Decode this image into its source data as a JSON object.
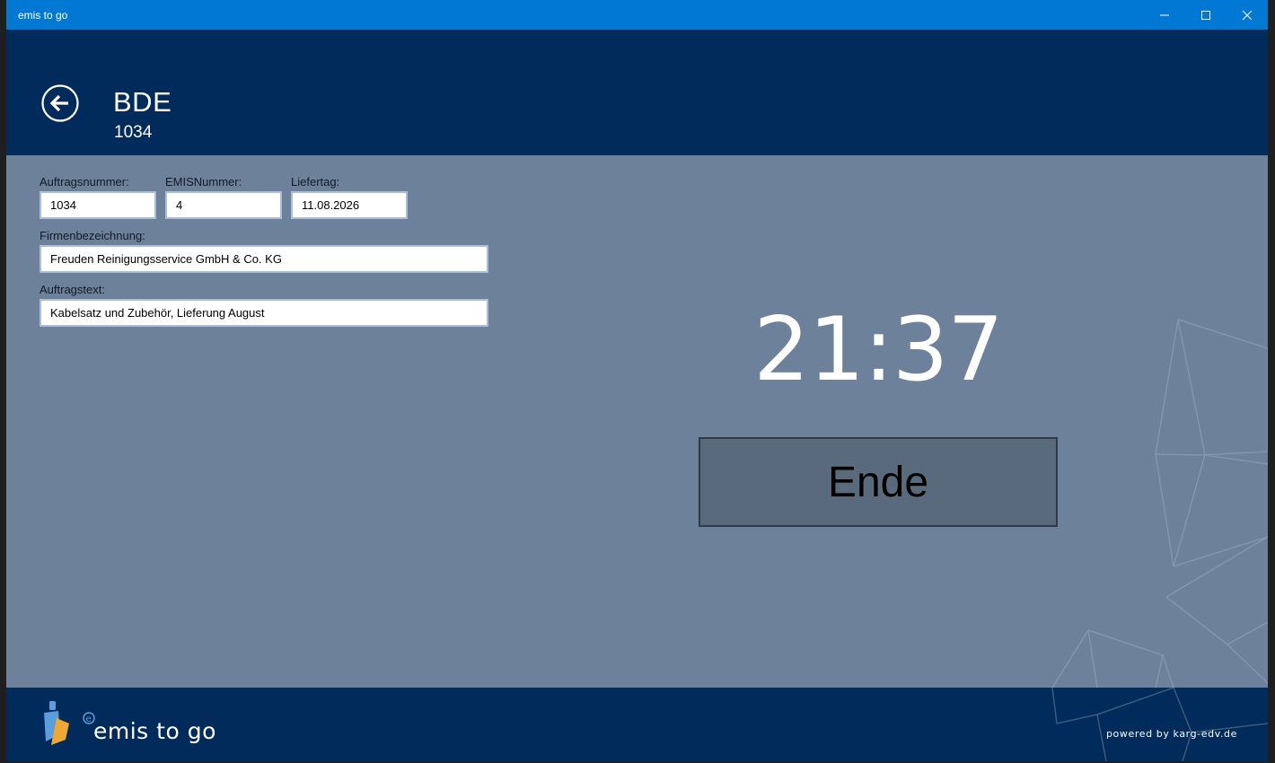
{
  "window": {
    "title": "emis to go",
    "controls": {
      "minimize": "minimize-icon",
      "maximize": "maximize-icon",
      "close": "close-icon"
    }
  },
  "header": {
    "back_icon": "back-arrow-icon",
    "title": "BDE",
    "subtitle": "1034"
  },
  "form": {
    "auftragsnummer": {
      "label": "Auftragsnummer:",
      "value": "1034"
    },
    "emisnummer": {
      "label": "EMISNummer:",
      "value": "4"
    },
    "liefertag": {
      "label": "Liefertag:",
      "value": "11.08.2026"
    },
    "firmenbezeichnung": {
      "label": "Firmenbezeichnung:",
      "value": "Freuden Reinigungsservice GmbH & Co. KG"
    },
    "auftragstext": {
      "label": "Auftragstext:",
      "value": "Kabelsatz und Zubehör, Lieferung August"
    }
  },
  "clock": {
    "time": "21:37"
  },
  "actions": {
    "end_label": "Ende"
  },
  "footer": {
    "logo_text": "emis to go",
    "powered_by": "powered by karg-edv.de"
  },
  "colors": {
    "titlebar": "#0178d4",
    "header": "#002b5a",
    "content": "#6d819b",
    "end_button": "#5a6a7d"
  }
}
